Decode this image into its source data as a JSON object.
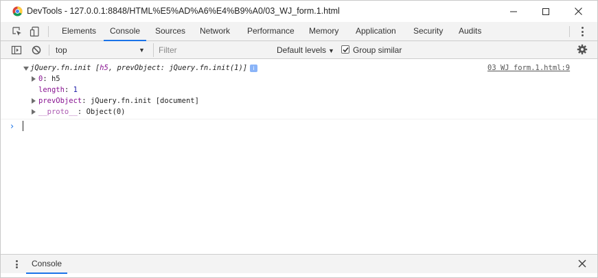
{
  "window": {
    "title": "DevTools - 127.0.0.1:8848/HTML%E5%AD%A6%E4%B9%A0/03_WJ_form.1.html",
    "controls": [
      "minimize-icon",
      "maximize-icon",
      "close-icon"
    ]
  },
  "tabs": [
    {
      "label": "Elements",
      "active": false
    },
    {
      "label": "Console",
      "active": true
    },
    {
      "label": "Sources",
      "active": false
    },
    {
      "label": "Network",
      "active": false
    },
    {
      "label": "Performance",
      "active": false
    },
    {
      "label": "Memory",
      "active": false
    },
    {
      "label": "Application",
      "active": false
    },
    {
      "label": "Security",
      "active": false
    },
    {
      "label": "Audits",
      "active": false
    }
  ],
  "toolbar": {
    "context": "top",
    "filter_placeholder": "Filter",
    "levels": "Default levels",
    "group_similar": "Group similar",
    "group_similar_checked": true
  },
  "console": {
    "message": {
      "prefix": "jQuery.fn.init [",
      "first": "h5",
      "middle": ", prevObject: jQuery.fn.init(1)]",
      "source": "03 WJ form.1.html:9",
      "props": [
        {
          "key": "0",
          "sep": ": ",
          "value": "h5"
        },
        {
          "key": "length",
          "sep": ": ",
          "value": "1"
        },
        {
          "key": "prevObject",
          "sep": ": ",
          "value": "jQuery.fn.init [document]"
        },
        {
          "key": "__proto__",
          "sep": ": ",
          "value": "Object(0)"
        }
      ],
      "info_badge": "i"
    },
    "prompt_glyph": "›"
  },
  "drawer": {
    "tab_label": "Console"
  },
  "colors": {
    "accent": "#1a73e8",
    "property_key": "#881391",
    "number": "#1a1aa6"
  }
}
